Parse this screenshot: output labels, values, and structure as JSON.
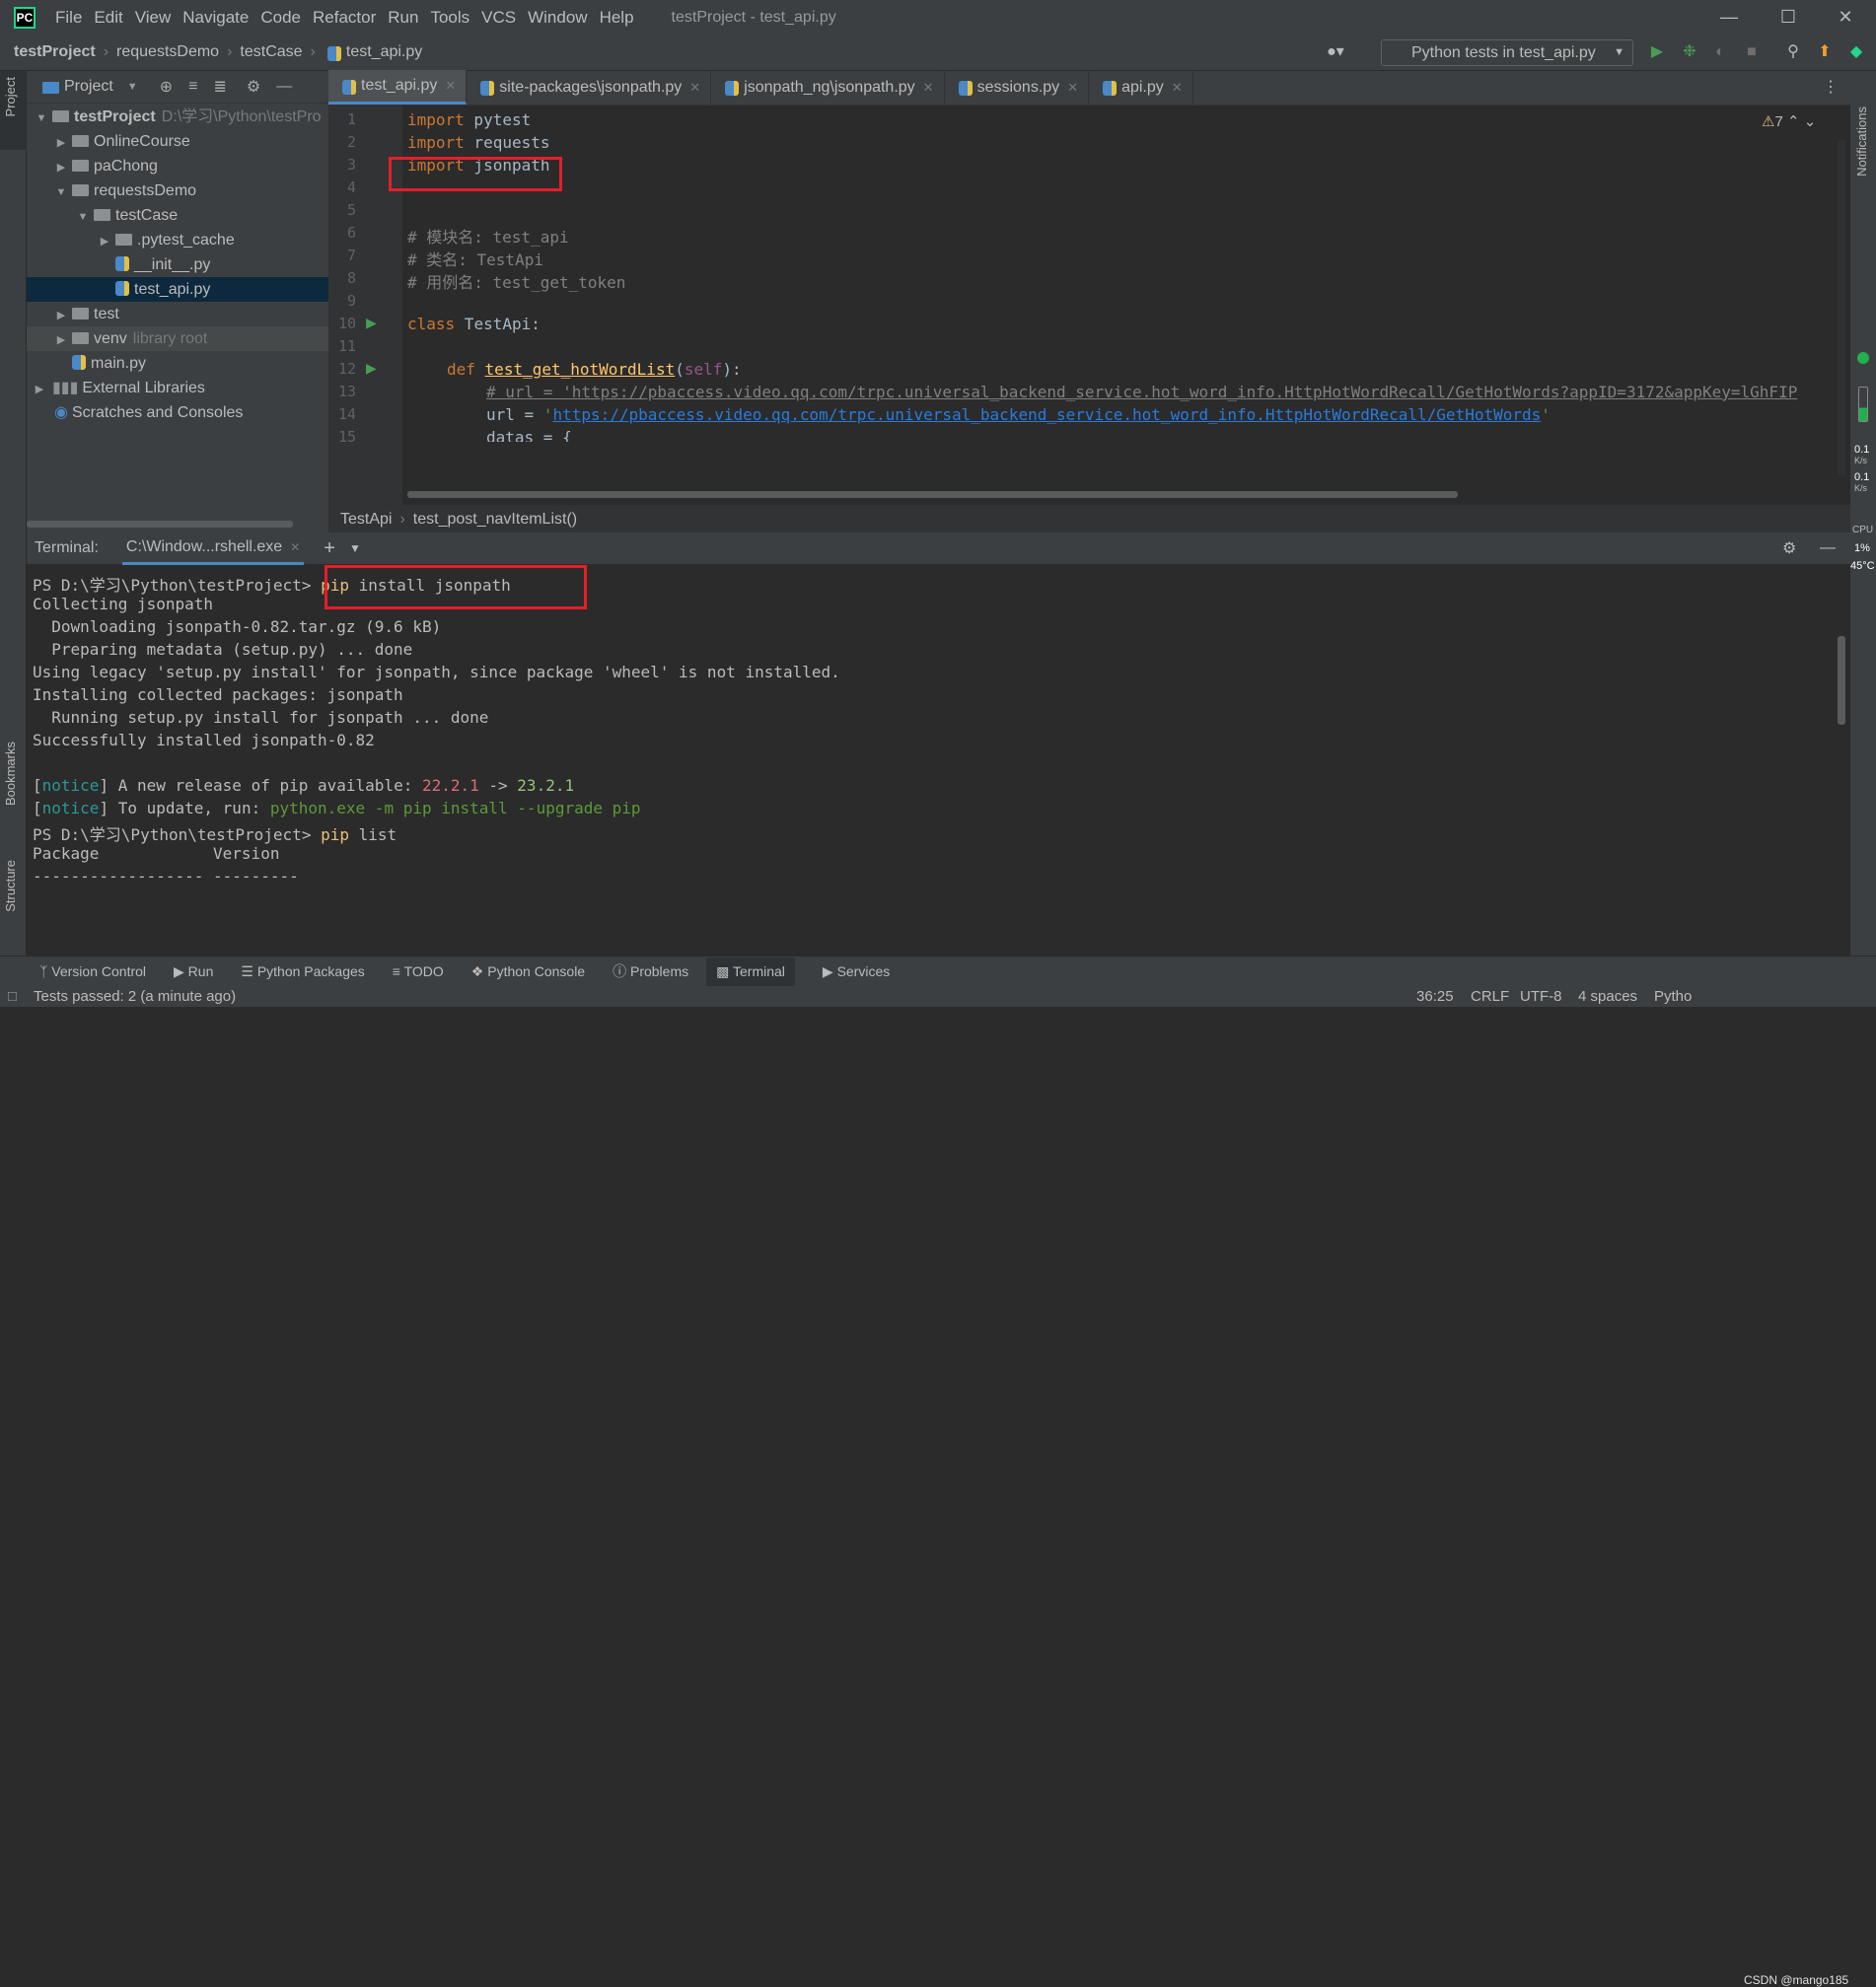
{
  "menubar": {
    "logo": "PC",
    "items": [
      "File",
      "Edit",
      "View",
      "Navigate",
      "Code",
      "Refactor",
      "Run",
      "Tools",
      "VCS",
      "Window",
      "Help"
    ],
    "window_title": "testProject - test_api.py"
  },
  "navbar": {
    "breadcrumbs": [
      "testProject",
      "requestsDemo",
      "testCase",
      "test_api.py"
    ],
    "run_config": "Python tests in test_api.py"
  },
  "project_panel": {
    "title": "Project",
    "tree": [
      {
        "label": "testProject",
        "extra": "D:\\学习\\Python\\testPro",
        "bold": true
      },
      {
        "label": "OnlineCourse"
      },
      {
        "label": "paChong"
      },
      {
        "label": "requestsDemo"
      },
      {
        "label": "testCase"
      },
      {
        "label": ".pytest_cache"
      },
      {
        "label": "__init__.py"
      },
      {
        "label": "test_api.py"
      },
      {
        "label": "test"
      },
      {
        "label": "venv",
        "extra": "library root"
      },
      {
        "label": "main.py"
      },
      {
        "label": "External Libraries"
      },
      {
        "label": "Scratches and Consoles"
      }
    ]
  },
  "editor": {
    "tabs": [
      "test_api.py",
      "site-packages\\jsonpath.py",
      "jsonpath_ng\\jsonpath.py",
      "sessions.py",
      "api.py"
    ],
    "warnings": "7",
    "line_numbers": [
      "1",
      "2",
      "3",
      "4",
      "5",
      "6",
      "7",
      "8",
      "9",
      "10",
      "11",
      "12",
      "13",
      "14",
      "15"
    ],
    "lines": {
      "l1_kw": "import",
      "l1_rest": " pytest",
      "l2_kw": "import",
      "l2_rest": " requests",
      "l3_kw": "import",
      "l3_rest": " jsonpath",
      "l6": "# 模块名: test_api",
      "l7": "# 类名: TestApi",
      "l8": "# 用例名: test_get_token",
      "l10_kw": "class",
      "l10_rest": " TestApi:",
      "l12_kw": "def",
      "l12_fn": "test_get_hotWordList",
      "l12_open": "(",
      "l12_self": "self",
      "l12_close": "):",
      "l13": "# url = 'https://pbaccess.video.qq.com/trpc.universal_backend_service.hot_word_info.HttpHotWordRecall/GetHotWords?appID=3172&appKey=lGhFIP",
      "l14_pre": "url = ",
      "l14_q": "'",
      "l14_url": "https://pbaccess.video.qq.com/trpc.universal_backend_service.hot_word_info.HttpHotWordRecall/GetHotWords",
      "l14_q2": "'",
      "l15": "datas = {"
    },
    "breadcrumb": [
      "TestApi",
      "test_post_navItemList()"
    ]
  },
  "terminal": {
    "label": "Terminal:",
    "tab": "C:\\Window...rshell.exe",
    "prompt": "PS D:\\学习\\Python\\testProject>",
    "cmd1_pip": "pip",
    "cmd1_rest": " install jsonpath",
    "out": [
      "Collecting jsonpath",
      "  Downloading jsonpath-0.82.tar.gz (9.6 kB)",
      "  Preparing metadata (setup.py) ... done",
      "Using legacy 'setup.py install' for jsonpath, since package 'wheel' is not installed.",
      "Installing collected packages: jsonpath",
      "  Running setup.py install for jsonpath ... done",
      "Successfully installed jsonpath-0.82"
    ],
    "notice_tag": "notice",
    "notice1_text": " A new release of pip available: ",
    "notice1_old": "22.2.1",
    "notice1_arrow": " -> ",
    "notice1_new": "23.2.1",
    "notice2_text": " To update, run: ",
    "notice2_cmd": "python.exe -m pip install --upgrade pip",
    "cmd2_pip": "pip",
    "cmd2_rest": " list",
    "table_header": "Package            Version",
    "table_rule": "------------------ ---------"
  },
  "bottom_tools": [
    "Version Control",
    "Run",
    "Python Packages",
    "TODO",
    "Python Console",
    "Problems",
    "Terminal",
    "Services"
  ],
  "side_labels": {
    "project": "Project",
    "bookmarks": "Bookmarks",
    "structure": "Structure",
    "notifications": "Notifications"
  },
  "monitor": {
    "net1": "0.1",
    "net2": "0.1",
    "unit": "K/s",
    "cpu_label": "CPU",
    "cpu": "1%",
    "temp": "45°C"
  },
  "statusbar": {
    "message": "Tests passed: 2 (a minute ago)",
    "position": "36:25",
    "line_sep": "CRLF",
    "encoding": "UTF-8",
    "indent": "4 spaces",
    "interpreter": "Pytho",
    "watermark": "CSDN @mango185"
  },
  "colors": {
    "accent": "#4a88c7",
    "highlight_box": "#e2202a",
    "run_green": "#499c54"
  }
}
